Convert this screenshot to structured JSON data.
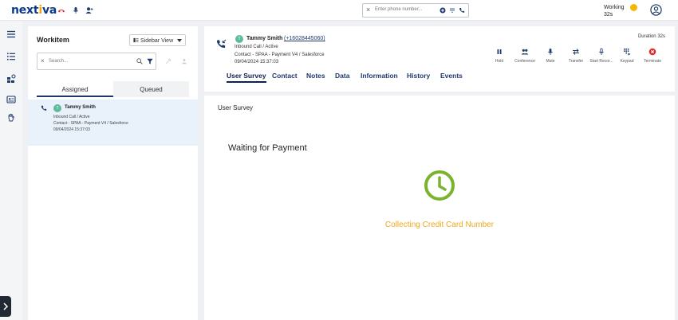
{
  "brand": {
    "logo": "nextiva",
    "accent": "#f5a300",
    "navy": "#0b3a8c"
  },
  "topbar": {
    "phone_placeholder": "Enter phone number...",
    "status": "Working",
    "status_time": "32s",
    "status_color": "#f5b800"
  },
  "workitem": {
    "title": "Workitem",
    "view_select": "Sidebar View",
    "search_placeholder": "Search...",
    "tabs": [
      {
        "label": "Assigned"
      },
      {
        "label": "Queued"
      }
    ],
    "item": {
      "name": "Tammy Smith",
      "avatar": "T",
      "line1": "Inbound Call / Active",
      "line2": "Contact - SPAA - Payment V4 / Salesforce",
      "line3": "09/04/2024 15:37:03"
    }
  },
  "call": {
    "name": "Tammy Smith",
    "avatar": "T",
    "phone": "(+16028445060)",
    "line1": "Inbound Call / Active",
    "line2": "Contact - SPAA - Payment V4 / Salesforce",
    "line3": "09/04/2024 15:37:03",
    "duration": "Duration 32s",
    "controls": [
      {
        "label": "Hold",
        "icon": "pause-icon"
      },
      {
        "label": "Conference",
        "icon": "conference-icon"
      },
      {
        "label": "Mute",
        "icon": "microphone-icon"
      },
      {
        "label": "Transfer",
        "icon": "transfer-icon"
      },
      {
        "label": "Start Recor...",
        "icon": "record-icon"
      },
      {
        "label": "Keypad",
        "icon": "keypad-icon"
      },
      {
        "label": "Terminate",
        "icon": "terminate-icon"
      }
    ],
    "tabs": [
      {
        "label": "User Survey"
      },
      {
        "label": "Contact"
      },
      {
        "label": "Notes"
      },
      {
        "label": "Data"
      },
      {
        "label": "Information"
      },
      {
        "label": "History"
      },
      {
        "label": "Events"
      }
    ]
  },
  "survey": {
    "title": "User Survey",
    "waiting": "Waiting for Payment",
    "collecting": "Collecting Credit Card Number",
    "clock_color": "#7ab32e",
    "collecting_color": "#f0a818"
  }
}
